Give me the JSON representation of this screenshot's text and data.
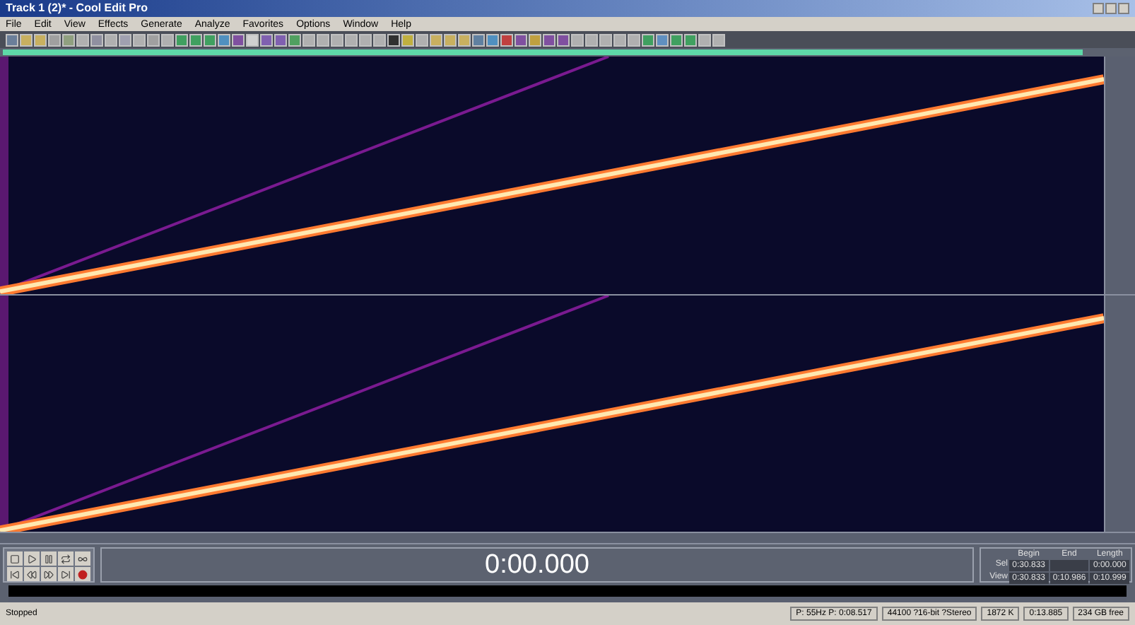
{
  "window": {
    "title": "Track 1 (2)* - Cool Edit Pro"
  },
  "menu": [
    "File",
    "Edit",
    "View",
    "Effects",
    "Generate",
    "Analyze",
    "Favorites",
    "Options",
    "Window",
    "Help"
  ],
  "time_display": "0:00.000",
  "region_panel": {
    "columns": [
      "Begin",
      "End",
      "Length"
    ],
    "rows": [
      {
        "label": "Sel",
        "cells": [
          "0:30.833",
          "",
          "0:00.000"
        ]
      },
      {
        "label": "View",
        "cells": [
          "0:30.833",
          "0:10.986",
          "0:10.999"
        ]
      }
    ]
  },
  "status_bar": {
    "left": "Stopped",
    "fields": [
      "P: 55Hz P: 0:08.517",
      "44100 ?16-bit ?Stereo",
      "1872 K",
      "0:13.885",
      "234 GB free"
    ]
  }
}
